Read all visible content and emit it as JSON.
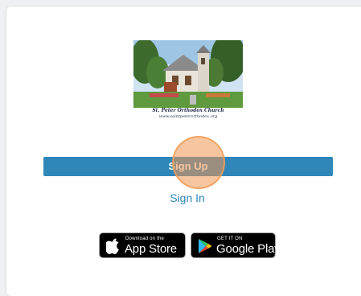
{
  "logo": {
    "caption_line1": "St. Peter Orthodox Church",
    "caption_line2": "www.saintpeterorthodox.org",
    "icon": "church-photo"
  },
  "actions": {
    "signup_label": "Sign Up",
    "signin_label": "Sign In"
  },
  "stores": {
    "apple_small": "Download on the",
    "apple_big": "App Store",
    "google_small": "GET IT ON",
    "google_big": "Google Play"
  },
  "colors": {
    "primary": "#2f86b9",
    "touch_indicator": "#f0a05a",
    "badge_bg": "#000000"
  }
}
